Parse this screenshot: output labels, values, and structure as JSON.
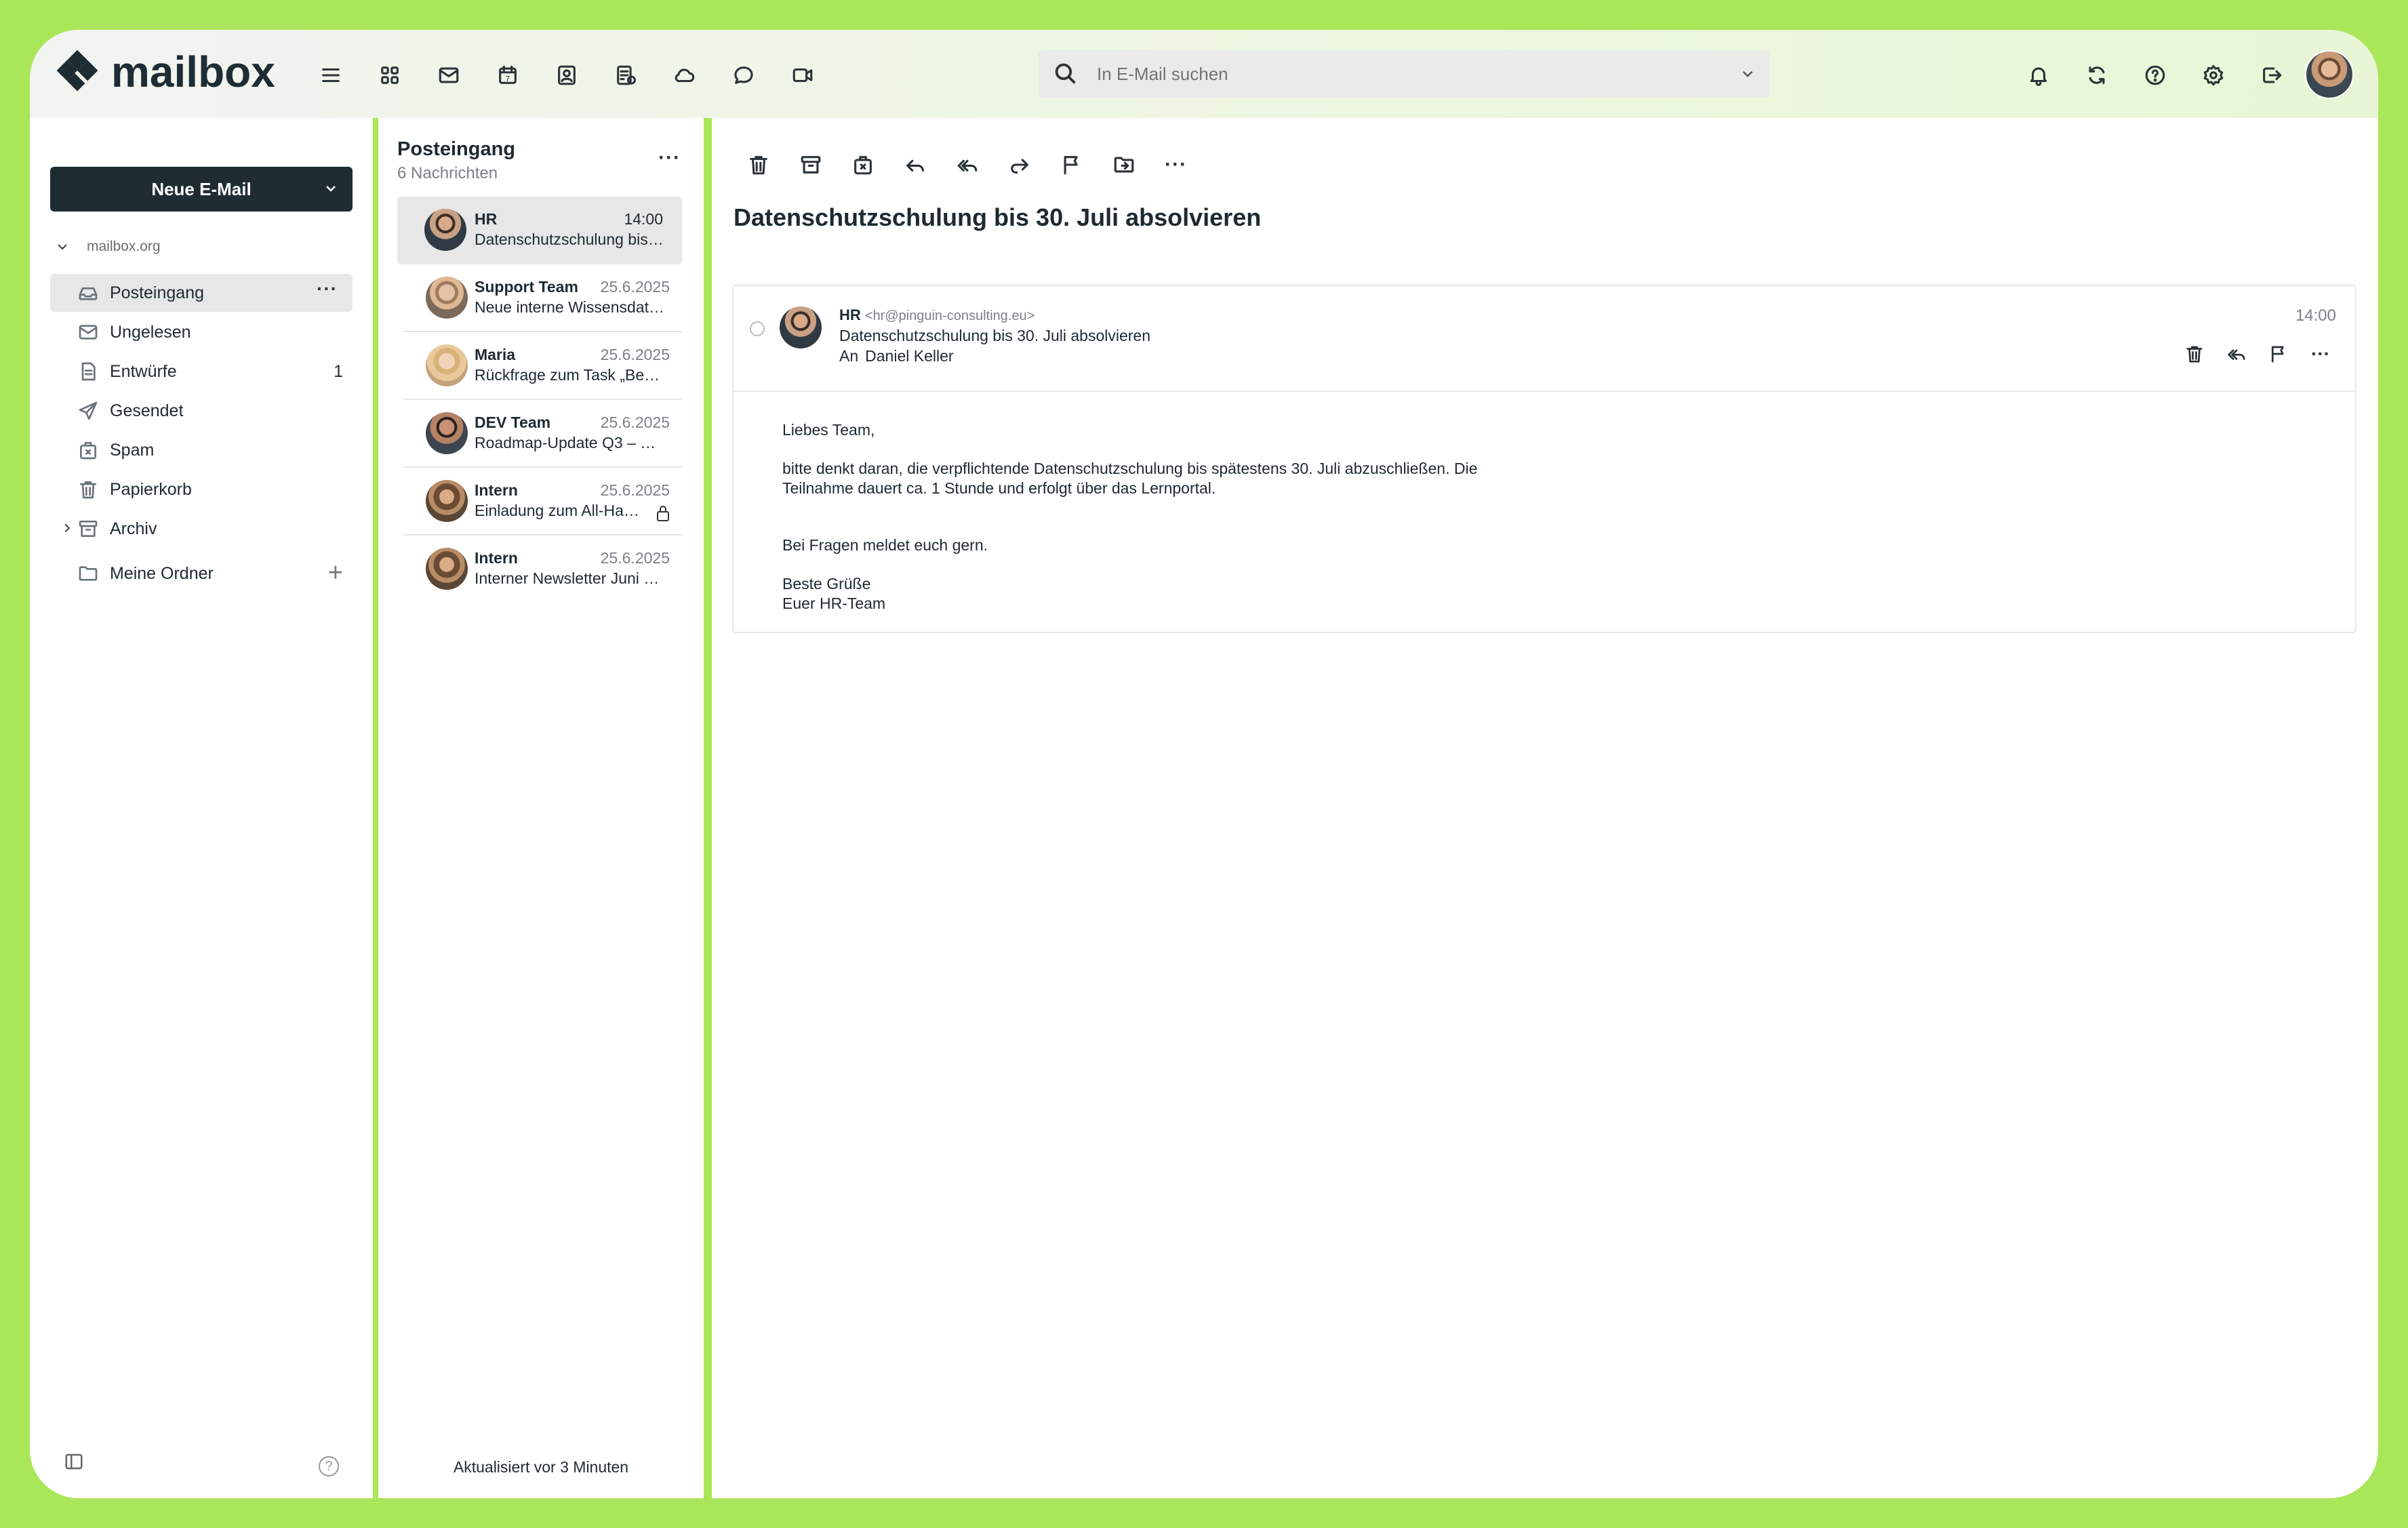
{
  "app": {
    "name": "mailbox",
    "accent_color": "#a9e65a",
    "dark_color": "#1f2d33"
  },
  "topbar": {
    "nav_icons": [
      "menu-icon",
      "apps-grid-icon",
      "mail-icon",
      "calendar-icon",
      "contacts-icon",
      "tasks-icon",
      "cloud-icon",
      "chat-icon",
      "video-icon"
    ],
    "calendar_day": "7",
    "search_placeholder": "In E-Mail suchen",
    "right_icons": [
      "bell-icon",
      "refresh-icon",
      "help-icon",
      "settings-icon",
      "logout-icon"
    ]
  },
  "sidebar": {
    "compose_label": "Neue E-Mail",
    "account": "mailbox.org",
    "folders": [
      {
        "label": "Posteingang",
        "icon": "inbox-icon",
        "count": "",
        "active": true
      },
      {
        "label": "Ungelesen",
        "icon": "mail-icon",
        "count": ""
      },
      {
        "label": "Entwürfe",
        "icon": "draft-icon",
        "count": "1"
      },
      {
        "label": "Gesendet",
        "icon": "send-icon",
        "count": ""
      },
      {
        "label": "Spam",
        "icon": "spam-icon",
        "count": ""
      },
      {
        "label": "Papierkorb",
        "icon": "trash-icon",
        "count": ""
      },
      {
        "label": "Archiv",
        "icon": "archive-icon",
        "count": ""
      }
    ],
    "my_folders_label": "Meine Ordner"
  },
  "message_list": {
    "title": "Posteingang",
    "subtitle": "6 Nachrichten",
    "items": [
      {
        "from": "HR",
        "time": "14:00",
        "subject": "Datenschutzschulung bis 30. Juli absolvieren",
        "selected": true
      },
      {
        "from": "Support Team",
        "time": "25.6.2025",
        "subject": "Neue interne Wissensdatenbank"
      },
      {
        "from": "Maria",
        "time": "25.6.2025",
        "subject": "Rückfrage zum Task „Benutzerverwaltung“"
      },
      {
        "from": "DEV Team",
        "time": "25.6.2025",
        "subject": "Roadmap-Update Q3 – Bitte lesen"
      },
      {
        "from": "Intern",
        "time": "25.6.2025",
        "subject": "Einladung zum All-Hands-Meeting",
        "locked": true
      },
      {
        "from": "Intern",
        "time": "25.6.2025",
        "subject": "Interner Newsletter Juni 2025"
      }
    ],
    "footer": "Aktualisiert vor 3 Minuten"
  },
  "reader": {
    "toolbar_icons": [
      "trash-icon",
      "archive-icon",
      "spam-icon",
      "reply-icon",
      "reply-all-icon",
      "forward-icon",
      "flag-icon",
      "move-icon",
      "more-icon"
    ],
    "title": "Datenschutzschulung bis 30. Juli absolvieren",
    "email": {
      "from_name": "HR",
      "from_addr": "<hr@pinguin-consulting.eu>",
      "subject": "Datenschutzschulung bis 30. Juli absolvieren",
      "to_label": "An",
      "to": "Daniel Keller",
      "time": "14:00",
      "body": [
        "Liebes Team,",
        "bitte denkt daran, die verpflichtende Datenschutzschulung bis spätestens 30. Juli abzuschließen. Die\nTeilnahme dauert ca. 1 Stunde und erfolgt über das Lernportal.",
        "Bei Fragen meldet euch gern.",
        "Beste Grüße\nEuer HR-Team"
      ]
    }
  }
}
